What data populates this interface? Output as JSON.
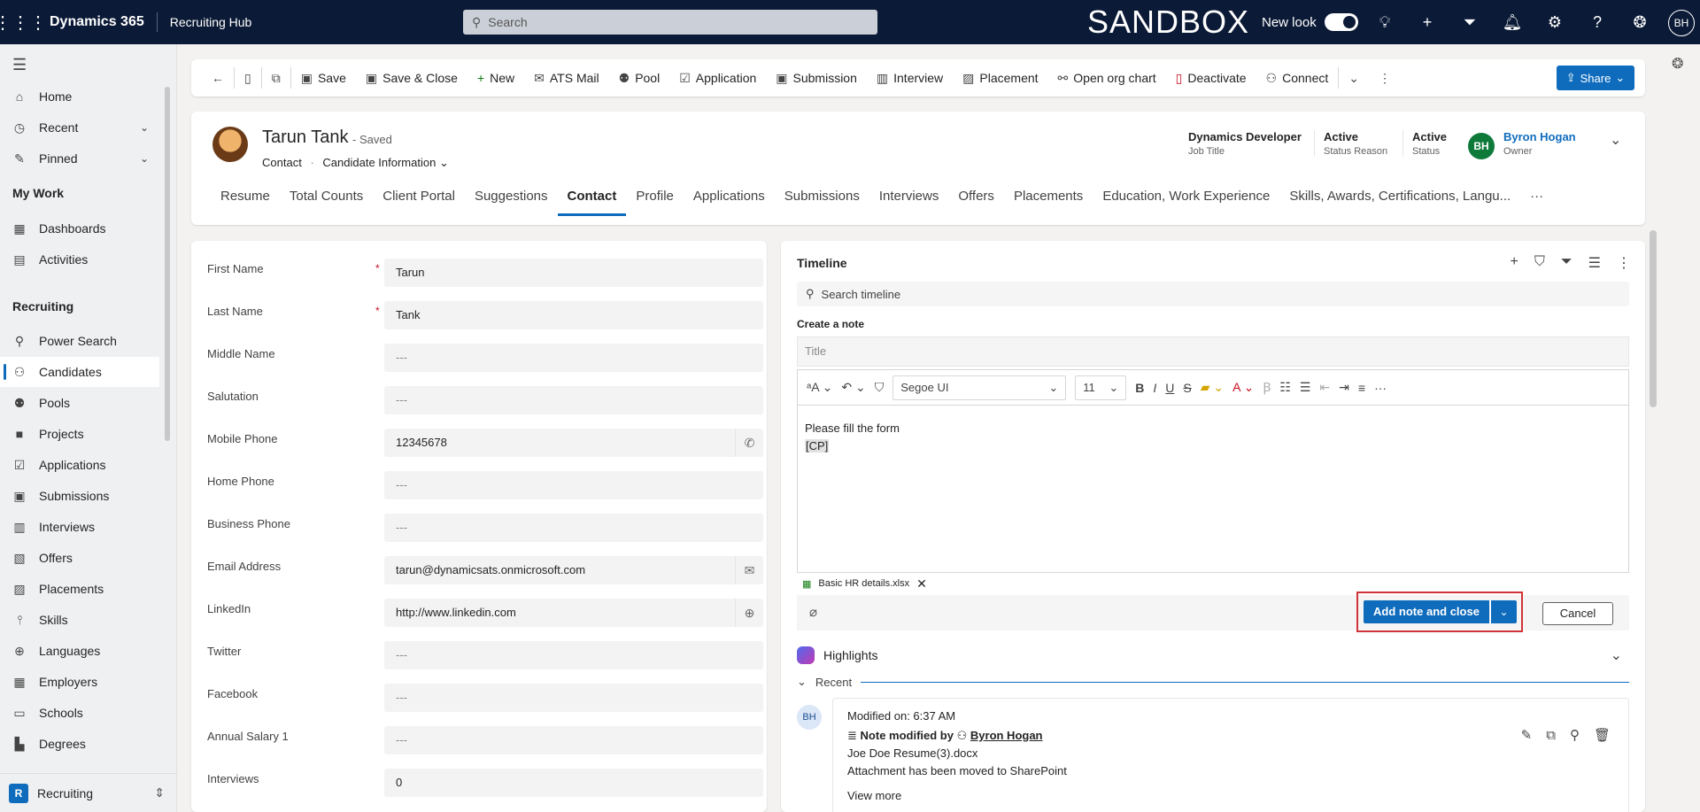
{
  "topbar": {
    "brand": "Dynamics 365",
    "app_name": "Recruiting Hub",
    "search_placeholder": "Search",
    "env_label": "SANDBOX",
    "new_look_label": "New look",
    "user_initials": "BH"
  },
  "sidebar": {
    "items_top": [
      {
        "label": "Home",
        "icon": "home-icon"
      },
      {
        "label": "Recent",
        "icon": "clock-icon"
      },
      {
        "label": "Pinned",
        "icon": "pin-icon"
      }
    ],
    "section_my_work": "My Work",
    "my_work": [
      {
        "label": "Dashboards"
      },
      {
        "label": "Activities"
      }
    ],
    "section_recruiting": "Recruiting",
    "recruiting": [
      {
        "label": "Power Search"
      },
      {
        "label": "Candidates"
      },
      {
        "label": "Pools"
      },
      {
        "label": "Projects"
      },
      {
        "label": "Applications"
      },
      {
        "label": "Submissions"
      },
      {
        "label": "Interviews"
      },
      {
        "label": "Offers"
      },
      {
        "label": "Placements"
      },
      {
        "label": "Skills"
      },
      {
        "label": "Languages"
      },
      {
        "label": "Employers"
      },
      {
        "label": "Schools"
      },
      {
        "label": "Degrees"
      }
    ],
    "area_badge": "R",
    "area_label": "Recruiting"
  },
  "commands": {
    "save": "Save",
    "save_close": "Save & Close",
    "new": "New",
    "ats_mail": "ATS Mail",
    "pool": "Pool",
    "application": "Application",
    "submission": "Submission",
    "interview": "Interview",
    "placement": "Placement",
    "org_chart": "Open org chart",
    "deactivate": "Deactivate",
    "connect": "Connect",
    "share": "Share"
  },
  "record": {
    "name": "Tarun Tank",
    "saved_state": "- Saved",
    "entity": "Contact",
    "form": "Candidate Information",
    "job_title_value": "Dynamics Developer",
    "job_title_label": "Job Title",
    "status_reason_value": "Active",
    "status_reason_label": "Status Reason",
    "status_value": "Active",
    "status_label": "Status",
    "owner_initials": "BH",
    "owner_name": "Byron Hogan",
    "owner_label": "Owner"
  },
  "tabs": [
    "Resume",
    "Total Counts",
    "Client Portal",
    "Suggestions",
    "Contact",
    "Profile",
    "Applications",
    "Submissions",
    "Interviews",
    "Offers",
    "Placements",
    "Education, Work Experience",
    "Skills, Awards, Certifications, Langu...",
    "···"
  ],
  "form_fields": [
    {
      "label": "First Name",
      "value": "Tarun",
      "required": "*"
    },
    {
      "label": "Last Name",
      "value": "Tank",
      "required": "*"
    },
    {
      "label": "Middle Name",
      "value": "---"
    },
    {
      "label": "Salutation",
      "value": "---"
    },
    {
      "label": "Mobile Phone",
      "value": "12345678"
    },
    {
      "label": "Home Phone",
      "value": "---"
    },
    {
      "label": "Business Phone",
      "value": "---"
    },
    {
      "label": "Email Address",
      "value": "tarun@dynamicsats.onmicrosoft.com"
    },
    {
      "label": "LinkedIn",
      "value": "http://www.linkedin.com"
    },
    {
      "label": "Twitter",
      "value": "---"
    },
    {
      "label": "Facebook",
      "value": "---"
    },
    {
      "label": "Annual Salary 1",
      "value": "---"
    },
    {
      "label": "Interviews",
      "value": "0"
    }
  ],
  "timeline": {
    "title": "Timeline",
    "search_placeholder": "Search timeline",
    "create_note": "Create a note",
    "title_placeholder": "Title",
    "font_name": "Segoe UI",
    "font_size": "11",
    "body_line1": "Please fill the form",
    "body_line2": "[CP]",
    "attachment_name": "Basic HR details.xlsx",
    "add_note_label": "Add note and close",
    "cancel_label": "Cancel",
    "highlights_label": "Highlights",
    "recent_label": "Recent",
    "entry": {
      "initials": "BH",
      "modified": "Modified on: 6:37 AM",
      "action": "Note modified by",
      "author": "Byron Hogan",
      "line1": "Joe Doe Resume(3).docx",
      "line2": "Attachment has been moved to SharePoint",
      "more": "View more"
    }
  },
  "colors": {
    "topbar": "#0b1a36",
    "accent": "#0f6cbd",
    "highlight_border": "#d13438"
  }
}
